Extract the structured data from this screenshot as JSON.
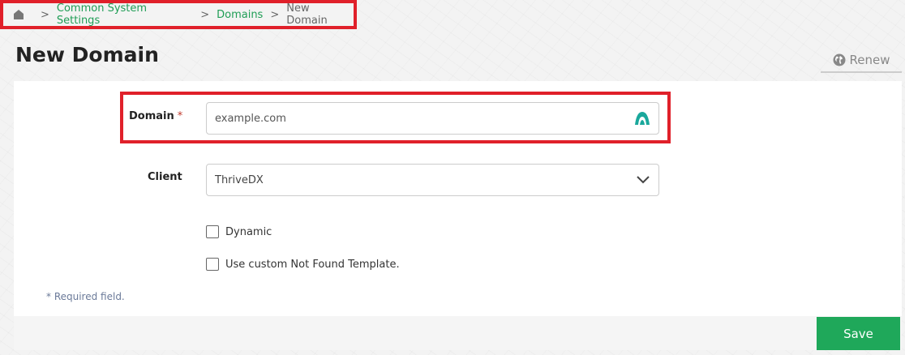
{
  "breadcrumb": {
    "items": [
      "Common System Settings",
      "Domains"
    ],
    "current": "New Domain",
    "separator": ">"
  },
  "page": {
    "title": "New Domain",
    "renew_label": "Renew"
  },
  "form": {
    "domain": {
      "label": "Domain",
      "required_marker": "*",
      "placeholder": "example.com"
    },
    "client": {
      "label": "Client",
      "value": "ThriveDX"
    },
    "options": [
      {
        "label": "Dynamic",
        "checked": false
      },
      {
        "label": "Use custom Not Found Template.",
        "checked": false
      }
    ],
    "required_note": "* Required field."
  },
  "actions": {
    "save_label": "Save"
  },
  "colors": {
    "link": "#1f9d55",
    "save_button": "#1fa85a",
    "highlight": "#e0202a",
    "domain_icon": "#1aa89c"
  }
}
